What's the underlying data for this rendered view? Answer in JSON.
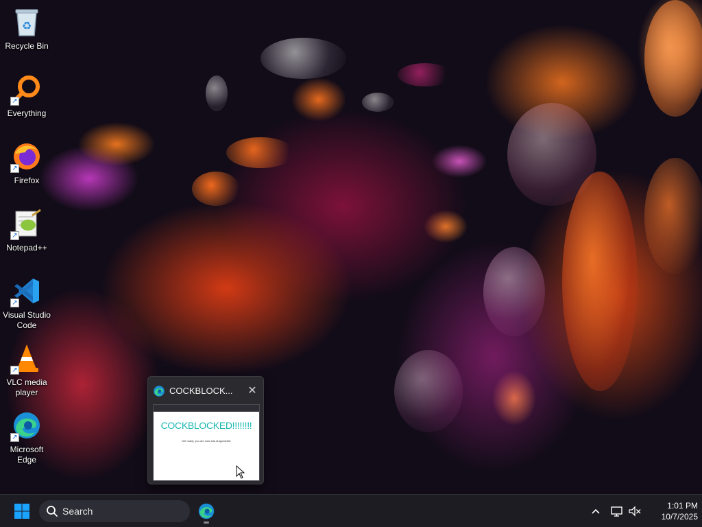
{
  "desktop": {
    "icons": [
      {
        "label": "Recycle Bin",
        "icon": "recycle-bin-icon"
      },
      {
        "label": "Everything",
        "icon": "everything-search-icon"
      },
      {
        "label": "Firefox",
        "icon": "firefox-icon"
      },
      {
        "label": "Notepad++",
        "icon": "notepadpp-icon"
      },
      {
        "label": "Visual Studio Code",
        "icon": "vscode-icon"
      },
      {
        "label": "VLC media player",
        "icon": "vlc-icon"
      },
      {
        "label": "Microsoft Edge",
        "icon": "edge-icon"
      }
    ]
  },
  "preview": {
    "title": "COCKBLOCK...",
    "close_glyph": "✕",
    "page_heading": "COCKBLOCKED!!!!!!!!",
    "page_subtext": "Get ready, you are now ada dragonsh#it."
  },
  "taskbar": {
    "search_placeholder": "Search",
    "chevron_glyph": "^",
    "time": "1:01 PM",
    "date": "10/7/2025"
  },
  "colors": {
    "taskbar_bg": "#1c1c22",
    "heading_teal": "#19b7b0",
    "windows_blue": "#1aa3ff"
  }
}
